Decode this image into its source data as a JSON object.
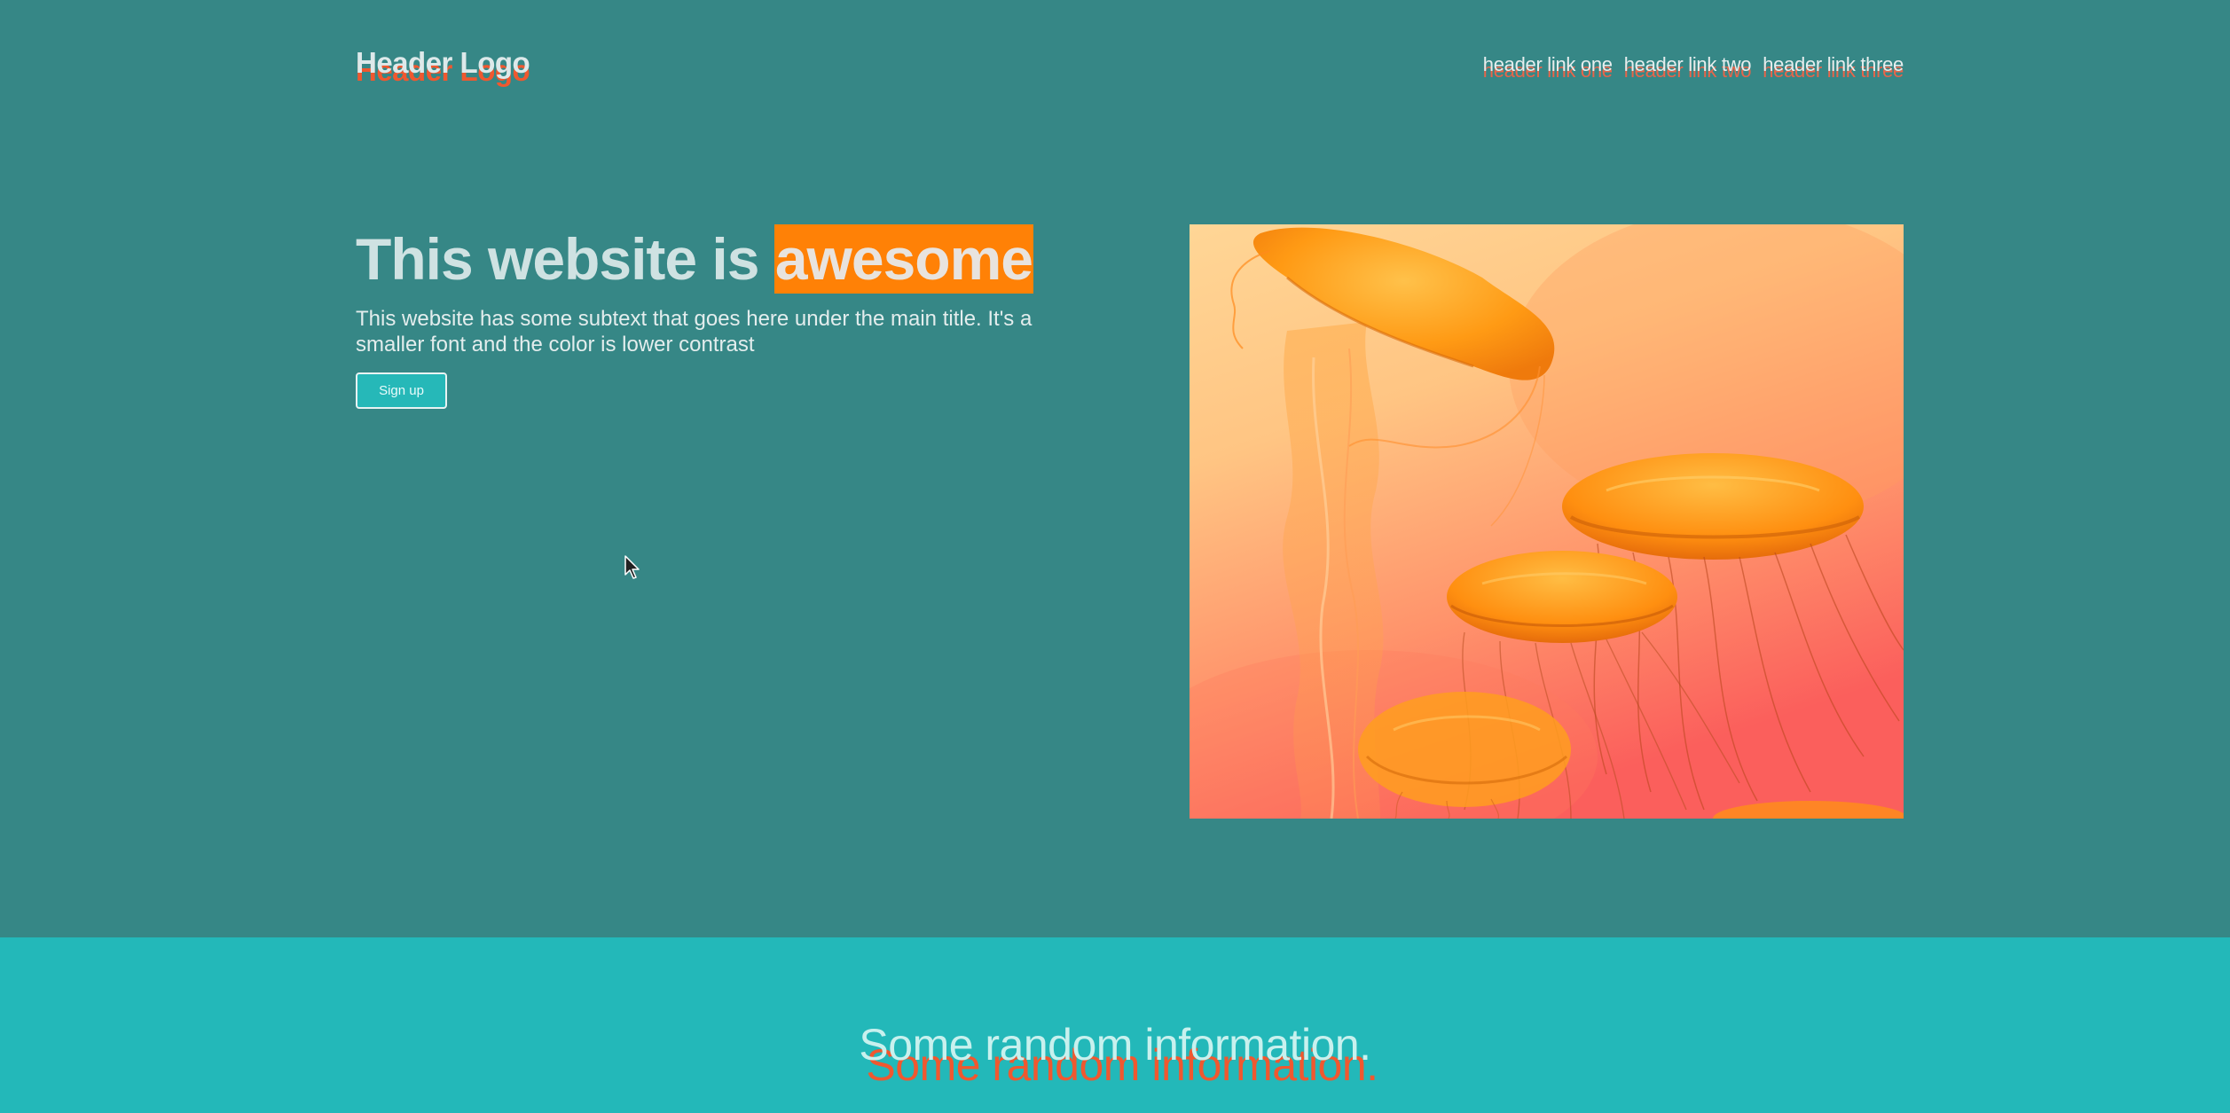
{
  "header": {
    "logo": "Header Logo",
    "nav": [
      "header link one",
      "header link two",
      "header link three"
    ]
  },
  "hero": {
    "title_prefix": "This website is ",
    "title_highlight": "awesome",
    "subtext": "This website has some subtext that goes here under the main title. It's a smaller font and the color is lower contrast",
    "button": "Sign up",
    "image_alt": "jellyfish-photo"
  },
  "info": {
    "title": "Some random information."
  },
  "colors": {
    "hero_bg": "#368786",
    "info_bg": "#23b8b9",
    "highlight": "#ff8106",
    "shadow_text": "#f0582f",
    "button_bg": "#26b8b8"
  }
}
